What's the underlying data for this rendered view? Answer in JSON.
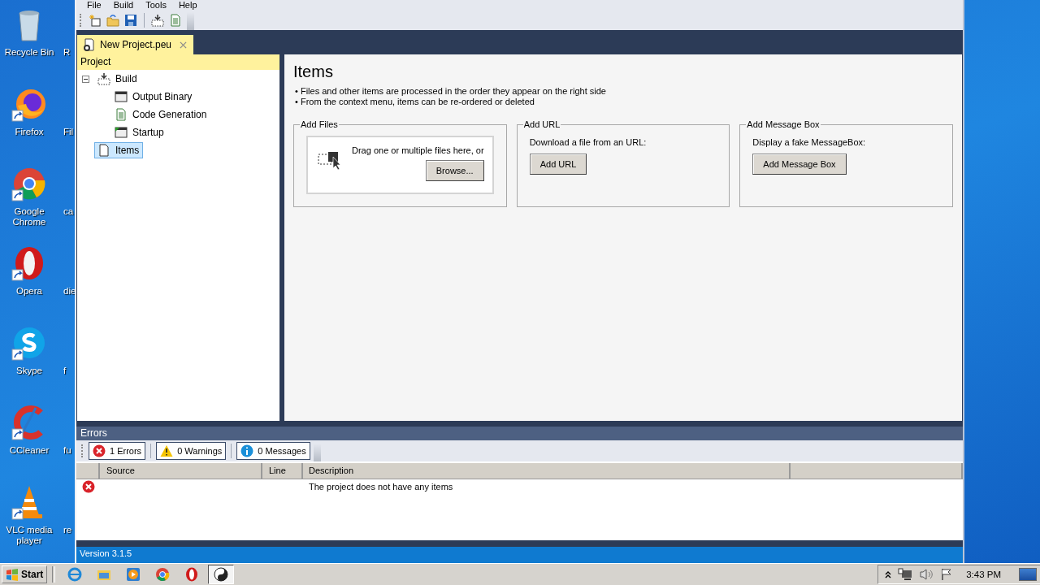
{
  "desktop": {
    "icons": [
      {
        "kind": "recycle",
        "label": "Recycle Bin",
        "partial": "R"
      },
      {
        "kind": "firefox",
        "label": "Firefox",
        "partial": "Fil"
      },
      {
        "kind": "chrome",
        "label": "Google Chrome",
        "partial": "ca"
      },
      {
        "kind": "opera",
        "label": "Opera",
        "partial": "die"
      },
      {
        "kind": "skype",
        "label": "Skype",
        "partial": "f"
      },
      {
        "kind": "ccleaner",
        "label": "CCleaner",
        "partial": "fu"
      },
      {
        "kind": "vlc",
        "label": "VLC media player",
        "partial": "re"
      }
    ]
  },
  "window": {
    "menu": [
      "File",
      "Build",
      "Tools",
      "Help"
    ],
    "tabs": [
      {
        "label": "New Project.peu",
        "selected": true
      }
    ],
    "tree": {
      "header": "Project",
      "items": [
        {
          "kind": "build",
          "label": "Build",
          "expanded": true,
          "selected": false,
          "children": [
            {
              "kind": "binary",
              "label": "Output Binary",
              "selected": false
            },
            {
              "kind": "code",
              "label": "Code Generation",
              "selected": false
            },
            {
              "kind": "startup",
              "label": "Startup",
              "selected": false
            }
          ]
        },
        {
          "kind": "items",
          "label": "Items",
          "selected": true
        }
      ]
    },
    "content": {
      "title": "Items",
      "bullets": [
        "• Files and other items are processed in the order they appear on the right side",
        "• From the context menu, items can be re-ordered or deleted"
      ],
      "groups": [
        {
          "kind": "drop",
          "title": "Add Files",
          "text": "Drag one or multiple files here, or",
          "button": "Browse..."
        },
        {
          "kind": "button",
          "title": "Add URL",
          "text": "Download a file from an URL:",
          "button": "Add URL"
        },
        {
          "kind": "button",
          "title": "Add Message Box",
          "text": "Display a fake MessageBox:",
          "button": "Add Message Box"
        }
      ]
    },
    "errors": {
      "title": "Errors",
      "filters": [
        {
          "kind": "error",
          "label": "1 Errors",
          "checked": true
        },
        {
          "kind": "warning",
          "label": "0 Warnings",
          "checked": true
        },
        {
          "kind": "info",
          "label": "0 Messages",
          "checked": true
        }
      ],
      "columns": [
        "Source",
        "Line",
        "Description"
      ],
      "rows": [
        {
          "kind": "error",
          "description": "The project does not have any items"
        }
      ]
    },
    "status_bar": "Version 3.1.5"
  },
  "taskbar": {
    "start": "Start",
    "apps": [
      {
        "kind": "ie",
        "selected": false
      },
      {
        "kind": "explorer",
        "selected": false
      },
      {
        "kind": "media",
        "selected": false
      },
      {
        "kind": "chrome",
        "selected": false
      },
      {
        "kind": "opera",
        "selected": false
      },
      {
        "kind": "app",
        "selected": true
      }
    ],
    "clock": "3:43 PM"
  }
}
